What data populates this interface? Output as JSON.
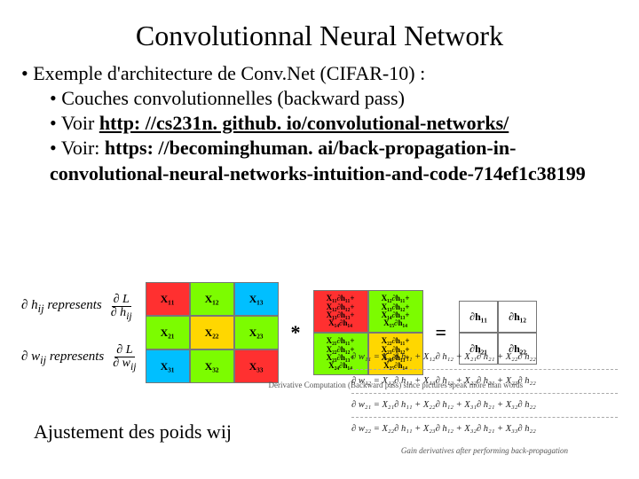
{
  "title": "Convolutionnal Neural Network",
  "bullets": {
    "l0": "Exemple d'architecture de Conv.Net  (CIFAR-10) :",
    "l1a": "Couches convolutionnelles (backward pass)",
    "l1b_prefix": "Voir ",
    "l1b_link": "http: //cs231n. github. io/convolutional-networks/",
    "l1c_prefix": "Voir: ",
    "l1c_bold": "https: //becominghuman. ai/back-propagation-in-convolutional-neural-networks-intuition-and-code-714ef1c38199"
  },
  "rep": {
    "dh_label": "∂ h",
    "dh_sub": "ij",
    "dh_word": "represents",
    "dw_label": "∂ w",
    "dw_sub": "ij",
    "dw_word": "represents",
    "dL": "∂ L",
    "dh_den": "∂ h",
    "dw_den": "∂ w"
  },
  "gridX": [
    "X₁₁",
    "X₁₂",
    "X₁₃",
    "X₂₁",
    "X₂₂",
    "X₂₃",
    "X₃₁",
    "X₃₂",
    "X₃₃"
  ],
  "gridX_colors": [
    "#ff3030",
    "#7cfc00",
    "#00bfff",
    "#7cfc00",
    "#ffd700",
    "#7cfc00",
    "#00bfff",
    "#7cfc00",
    "#ff3030"
  ],
  "gridDH_lines": [
    "X₁₁∂h₁₁+\nX₁₂∂h₁₂+\nX₁₃∂h₁₃+\nX₁₄∂h₁₄",
    "X₁₂∂h₁₁+\nX₁₃∂h₁₂+\nX₁₄∂h₁₃+\nX₁₅∂h₁₄",
    "X₂₁∂h₁₁+\nX₂₂∂h₁₂+\nX₂₃∂h₁₃+\nX₂₄∂h₁₄",
    "X₂₂∂h₁₁+\nX₂₃∂h₁₂+\nX₂₄∂h₁₃+\nX₂₅∂h₁₄"
  ],
  "gridDH_colors": [
    "#ff3030",
    "#7cfc00",
    "#7cfc00",
    "#ffd700"
  ],
  "gridDW": [
    "∂h₁₁",
    "∂h₁₂",
    "∂h₂₁",
    "∂h₂₂"
  ],
  "op_star": "*",
  "op_eq": "=",
  "caption1": "Derivative Computation (Backward pass) since pictures speak more than words",
  "weq": [
    "∂ w₁₁ = X₁₁∂ h₁₁ + X₁₂∂ h₁₂ + X₂₁∂ h₂₁ + X₂₂∂ h₂₂",
    "∂ w₁₂ = X₁₂∂ h₁₁ + X₁₃∂ h₁₂ + X₂₂∂ h₂₁ + X₂₃∂ h₂₂",
    "∂ w₂₁ = X₂₁∂ h₁₁ + X₂₂∂ h₁₂ + X₃₁∂ h₂₁ + X₃₂∂ h₂₂",
    "∂ w₂₂ = X₂₂∂ h₁₁ + X₂₃∂ h₁₂ + X₃₂∂ h₂₁ + X₃₃∂ h₂₂"
  ],
  "caption2": "Gain derivatives after performing back-propagation",
  "adj": "Ajustement des poids wij"
}
